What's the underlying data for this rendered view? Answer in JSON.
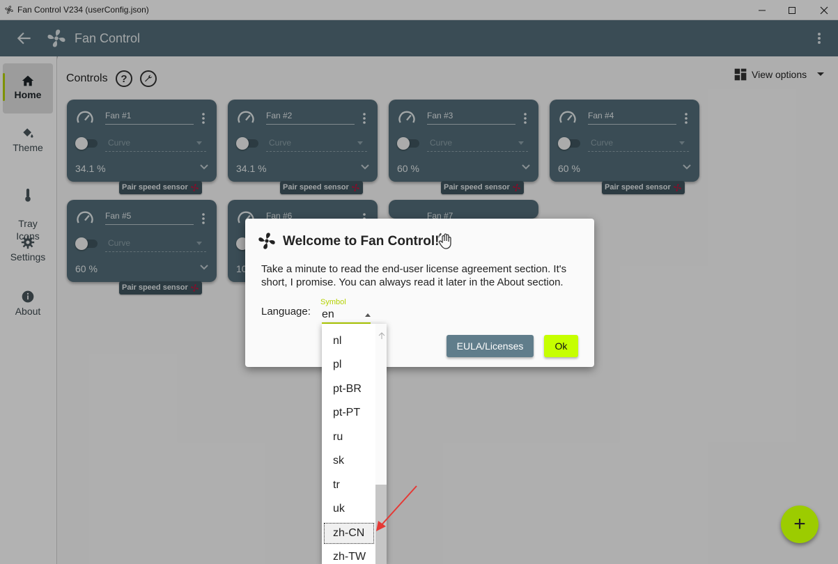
{
  "window": {
    "title": "Fan Control V234 (userConfig.json)"
  },
  "appbar": {
    "title": "Fan Control"
  },
  "sidebar": {
    "items": [
      {
        "label": "Home",
        "icon": "home-icon",
        "active": true
      },
      {
        "label": "Theme",
        "icon": "paint-bucket-icon"
      },
      {
        "label": "Tray\nIcons",
        "icon": "thermometer-icon"
      },
      {
        "label": "Settings",
        "icon": "gear-icon"
      },
      {
        "label": "About",
        "icon": "info-icon"
      }
    ]
  },
  "main": {
    "controls_label": "Controls",
    "help_symbol": "?",
    "view_options": "View options"
  },
  "cards": [
    {
      "name": "Fan #1",
      "curve": "Curve",
      "percent": "34.1 %",
      "pair": "Pair speed sensor"
    },
    {
      "name": "Fan #2",
      "curve": "Curve",
      "percent": "34.1 %",
      "pair": "Pair speed sensor"
    },
    {
      "name": "Fan #3",
      "curve": "Curve",
      "percent": "60 %",
      "pair": "Pair speed sensor"
    },
    {
      "name": "Fan #4",
      "curve": "Curve",
      "percent": "60 %",
      "pair": "Pair speed sensor"
    },
    {
      "name": "Fan #5",
      "curve": "Curve",
      "percent": "60 %",
      "pair": "Pair speed sensor"
    },
    {
      "name": "Fan #6",
      "curve": "",
      "percent": "10",
      "pair": ""
    },
    {
      "name": "Fan #7",
      "curve": "",
      "percent": "",
      "pair": ""
    }
  ],
  "dialog": {
    "title": "Welcome to Fan Control!",
    "body": "Take a minute to read the end-user license agreement section. It's short, I promise. You can always read it later in the About section.",
    "language_label": "Language:",
    "symbol_label": "Symbol",
    "language_value": "en",
    "eula_button": "EULA/Licenses",
    "ok_button": "Ok"
  },
  "dropdown": {
    "options": [
      "nl",
      "pl",
      "pt-BR",
      "pt-PT",
      "ru",
      "sk",
      "tr",
      "uk",
      "zh-CN",
      "zh-TW"
    ],
    "selected": "zh-CN"
  },
  "fab": {
    "label": "+"
  },
  "colors": {
    "accent": "#c6ff00",
    "card": "#536e7a",
    "appbar": "#536e7a",
    "pair_fan": "#c4123c",
    "annotation": "#e53935"
  }
}
